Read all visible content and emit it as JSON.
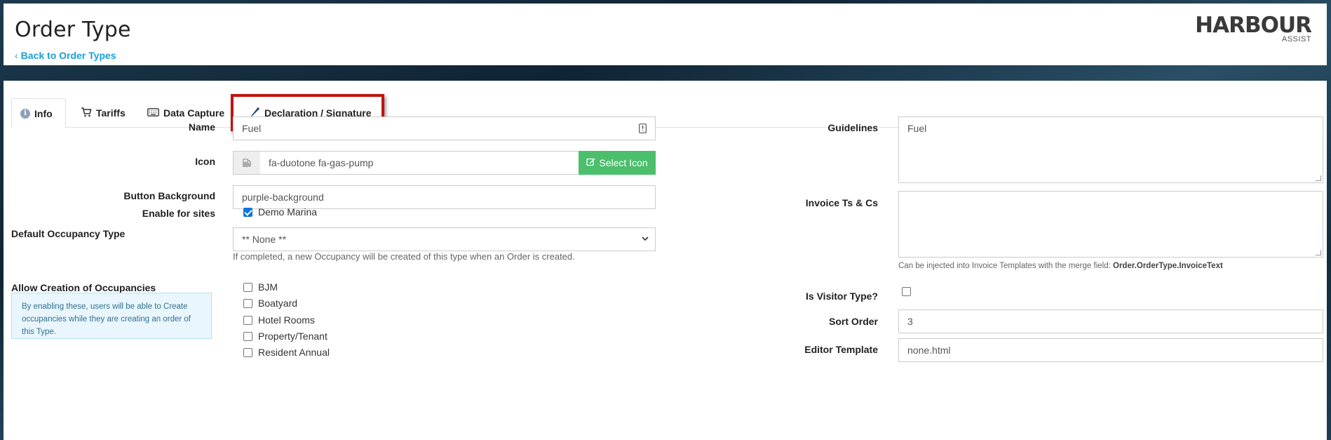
{
  "header": {
    "title": "Order Type",
    "back_link": "Back to Order Types",
    "logo_main": "HARBOUR",
    "logo_sub": "ASSIST"
  },
  "tabs": [
    {
      "label": "Info",
      "icon": "info-icon",
      "active": true
    },
    {
      "label": "Tariffs",
      "icon": "cart-icon"
    },
    {
      "label": "Data Capture",
      "icon": "keyboard-icon"
    },
    {
      "label": "Declaration / Signature",
      "icon": "pen-icon"
    }
  ],
  "form": {
    "name_label": "Name",
    "name_value": "Fuel",
    "icon_label": "Icon",
    "icon_value": "fa-duotone fa-gas-pump",
    "select_icon_label": "Select Icon",
    "button_bg_label": "Button Background",
    "button_bg_value": "purple-background",
    "enable_sites_label": "Enable for sites",
    "site_option": "Demo Marina",
    "default_occupancy_label": "Default Occupancy Type",
    "default_occupancy_value": "** None **",
    "default_occupancy_help": "If completed, a new Occupancy will be created of this type when an Order is created.",
    "allow_creation_label": "Allow Creation of Occupancies",
    "allow_creation_note": "By enabling these, users will be able to Create occupancies while they are creating an order of this Type.",
    "occupancy_options": [
      "BJM",
      "Boatyard",
      "Hotel Rooms",
      "Property/Tenant",
      "Resident Annual"
    ],
    "guidelines_label": "Guidelines",
    "guidelines_value": "Fuel",
    "invoice_tc_label": "Invoice Ts & Cs",
    "invoice_tc_value": "",
    "invoice_help_prefix": "Can be injected into Invoice Templates with the merge field: ",
    "invoice_help_field": "Order.OrderType.InvoiceText",
    "visitor_label": "Is Visitor Type?",
    "sort_order_label": "Sort Order",
    "sort_order_value": "3",
    "editor_template_label": "Editor Template",
    "editor_template_value": "none.html"
  },
  "colors": {
    "accent": "#1a9fd6",
    "success": "#4cbf6d",
    "highlight": "#c1140f"
  }
}
